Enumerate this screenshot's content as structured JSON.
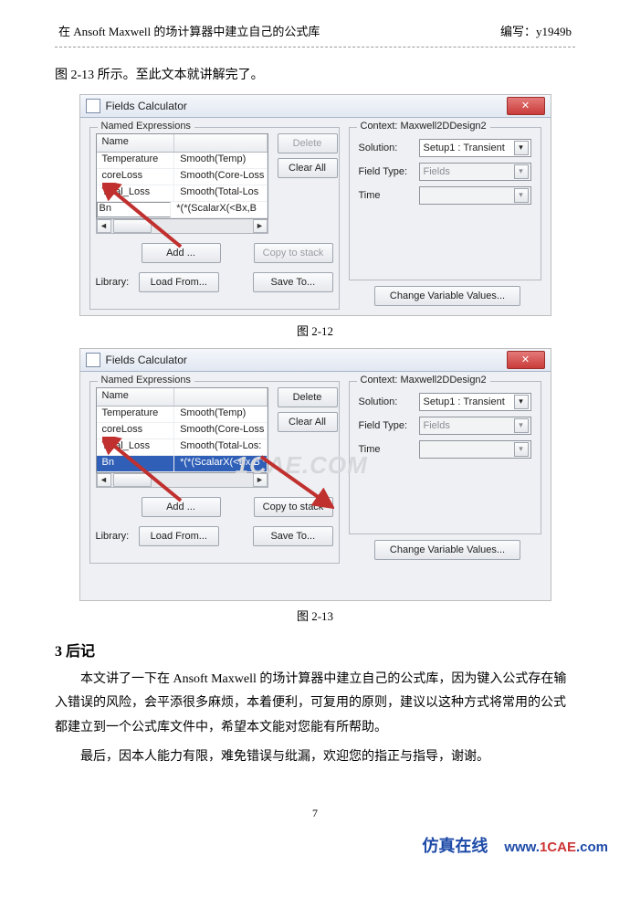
{
  "header": {
    "title": "在 Ansoft Maxwell 的场计算器中建立自己的公式库",
    "author_label": "编写：",
    "author": "y1949b"
  },
  "intro": "图 2-13 所示。至此文本就讲解完了。",
  "fig12": {
    "title": "Fields Calculator",
    "named_legend": "Named Expressions",
    "col_name": "Name",
    "rows": [
      {
        "name": "Temperature",
        "expr": "Smooth(Temp)"
      },
      {
        "name": "coreLoss",
        "expr": "Smooth(Core-Loss"
      },
      {
        "name": "Total_Loss",
        "expr": "Smooth(Total-Los"
      },
      {
        "name": "Bn",
        "expr": "*(*(ScalarX(<Bx,B"
      }
    ],
    "delete": "Delete",
    "clearall": "Clear All",
    "add": "Add ...",
    "copy": "Copy to stack",
    "library": "Library:",
    "loadfrom": "Load From...",
    "saveto": "Save To...",
    "ctx_legend": "Context: Maxwell2DDesign2",
    "solution": "Solution:",
    "solution_val": "Setup1 : Transient",
    "fieldtype": "Field Type:",
    "fieldtype_val": "Fields",
    "time": "Time",
    "change": "Change Variable Values...",
    "caption": "图 2-12"
  },
  "fig13": {
    "title": "Fields Calculator",
    "named_legend": "Named Expressions",
    "col_name": "Name",
    "rows": [
      {
        "name": "Temperature",
        "expr": "Smooth(Temp)"
      },
      {
        "name": "coreLoss",
        "expr": "Smooth(Core-Loss"
      },
      {
        "name": "Total_Loss",
        "expr": "Smooth(Total-Los:"
      },
      {
        "name": "Bn",
        "expr": "*(*(ScalarX(<Bx,B"
      }
    ],
    "delete": "Delete",
    "clearall": "Clear All",
    "add": "Add ...",
    "copy": "Copy to stack",
    "library": "Library:",
    "loadfrom": "Load From...",
    "saveto": "Save To...",
    "ctx_legend": "Context: Maxwell2DDesign2",
    "solution": "Solution:",
    "solution_val": "Setup1 : Transient",
    "fieldtype": "Field Type:",
    "fieldtype_val": "Fields",
    "time": "Time",
    "change": "Change Variable Values...",
    "caption": "图 2-13"
  },
  "watermark": "1CAE.COM",
  "section": {
    "num": "3",
    "title": "后记"
  },
  "para1": "本文讲了一下在 Ansoft  Maxwell 的场计算器中建立自己的公式库，因为键入公式存在输入错误的风险，会平添很多麻烦，本着便利，可复用的原则，建议以这种方式将常用的公式都建立到一个公式库文件中，希望本文能对您能有所帮助。",
  "para2": "最后，因本人能力有限，难免错误与纰漏，欢迎您的指正与指导，谢谢。",
  "pagenum": "7",
  "footer": {
    "brand": "仿真在线",
    "url_prefix": "www.",
    "url_mid": "1CAE",
    "url_suffix": ".com"
  }
}
